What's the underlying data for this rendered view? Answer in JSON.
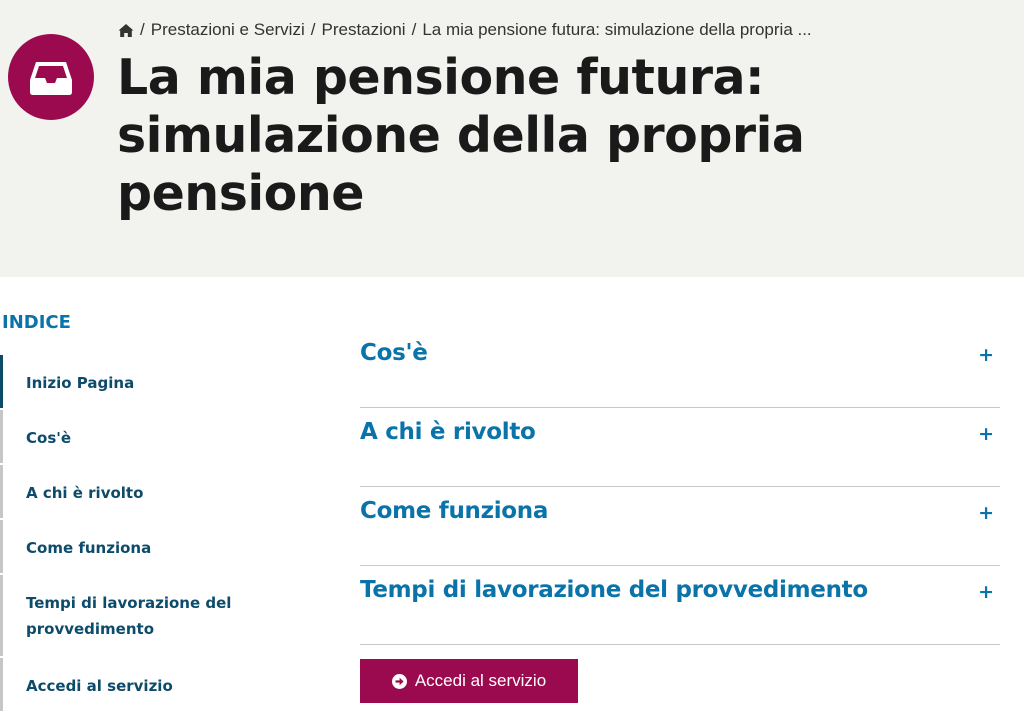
{
  "breadcrumb": {
    "home_icon": "home-icon",
    "items": [
      "Prestazioni e Servizi",
      "Prestazioni",
      "La mia pensione futura: simulazione della propria ..."
    ],
    "separator": "/"
  },
  "page": {
    "title": "La mia pensione futura: simulazione della propria pensione",
    "icon": "inbox-tray-icon"
  },
  "toc": {
    "title": "INDICE",
    "items": [
      "Inizio Pagina",
      "Cos'è",
      "A chi è rivolto",
      "Come funziona",
      "Tempi di lavorazione del provvedimento",
      "Accedi al servizio"
    ],
    "active_index": 0
  },
  "accordion": {
    "items": [
      {
        "label": "Cos'è",
        "toggle": "+"
      },
      {
        "label": "A chi è rivolto",
        "toggle": "+"
      },
      {
        "label": "Come funziona",
        "toggle": "+"
      },
      {
        "label": "Tempi di lavorazione del provvedimento",
        "toggle": "+"
      }
    ]
  },
  "cta": {
    "label": "Accedi al servizio",
    "icon": "arrow-circle-right-icon"
  },
  "colors": {
    "brand_magenta": "#9b0a4e",
    "link_blue": "#0a73a9",
    "toc_dark_blue": "#0d4b6b",
    "hero_bg": "#f2f2ee"
  }
}
